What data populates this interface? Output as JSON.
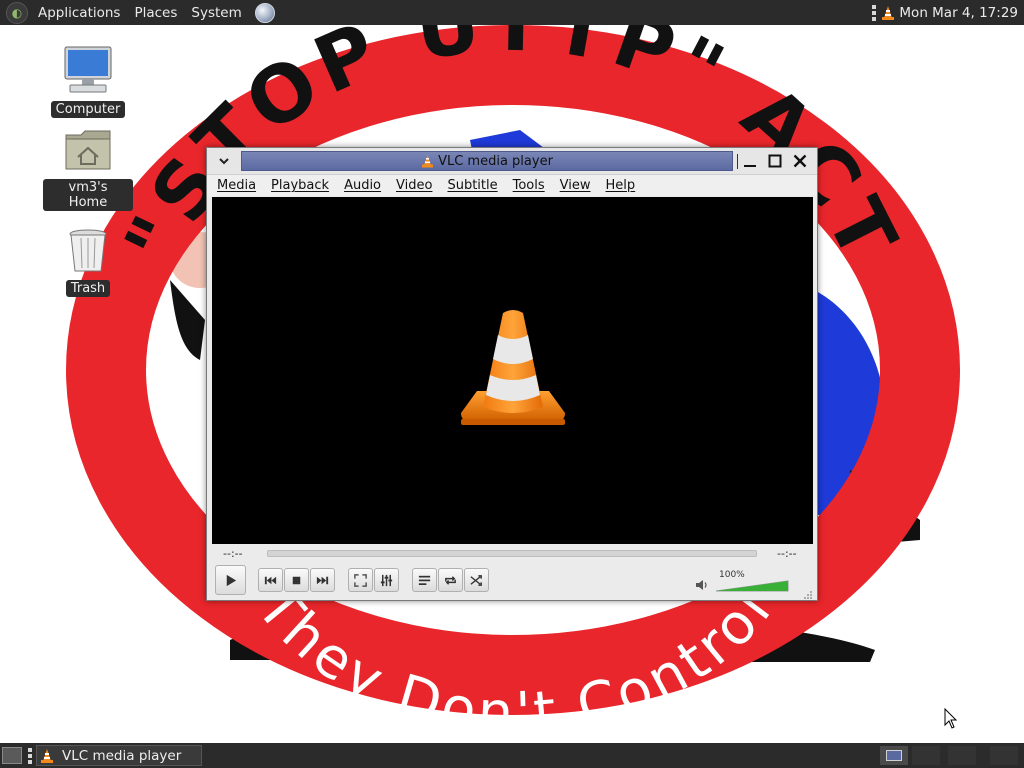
{
  "top_panel": {
    "menus": [
      "Applications",
      "Places",
      "System"
    ],
    "clock": "Mon Mar  4, 17:29"
  },
  "desktop": {
    "icons": [
      {
        "label": "Computer",
        "icon": "computer-icon"
      },
      {
        "label": "vm3's Home",
        "icon": "home-folder-icon"
      },
      {
        "label": "Trash",
        "icon": "trash-icon"
      }
    ],
    "wallpaper": {
      "top_text": "\"STOP UTTP\" ACT",
      "bottom_text": "They Don't Control",
      "ring_color": "#e8262b"
    }
  },
  "vlc": {
    "title": "VLC media player",
    "menus": [
      "Media",
      "Playback",
      "Audio",
      "Video",
      "Subtitle",
      "Tools",
      "View",
      "Help"
    ],
    "time_elapsed": "--:--",
    "time_total": "--:--",
    "volume": "100%",
    "volume_level": 1.0,
    "accent": "#ff8800"
  },
  "taskbar": {
    "tasks": [
      {
        "label": "VLC media player",
        "icon": "vlc-cone-icon"
      }
    ]
  }
}
